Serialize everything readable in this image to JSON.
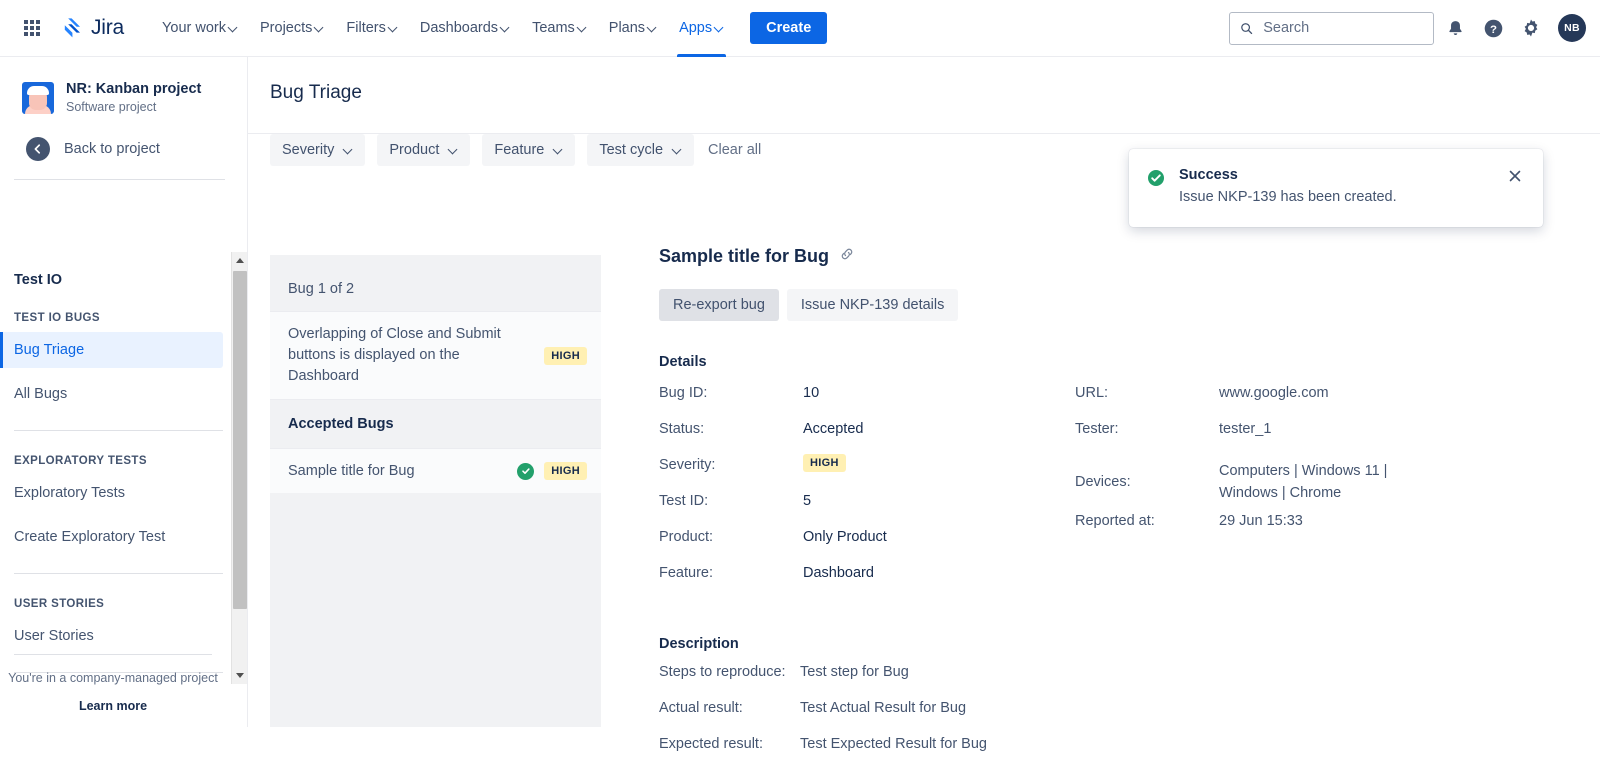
{
  "topnav": {
    "app_switcher": "app-switcher",
    "brand": "Jira",
    "items": [
      {
        "label": "Your work",
        "active": false
      },
      {
        "label": "Projects",
        "active": false
      },
      {
        "label": "Filters",
        "active": false
      },
      {
        "label": "Dashboards",
        "active": false
      },
      {
        "label": "Teams",
        "active": false
      },
      {
        "label": "Plans",
        "active": false
      },
      {
        "label": "Apps",
        "active": true
      }
    ],
    "create_label": "Create",
    "search_placeholder": "Search",
    "search_value": "",
    "avatar_initials": "NB"
  },
  "sidebar": {
    "project_name": "NR: Kanban project",
    "project_type": "Software project",
    "back_label": "Back to project",
    "app_title": "Test IO",
    "groups": [
      {
        "label": "TEST IO BUGS",
        "items": [
          {
            "label": "Bug Triage",
            "selected": true
          },
          {
            "label": "All Bugs",
            "selected": false
          }
        ]
      },
      {
        "label": "EXPLORATORY TESTS",
        "items": [
          {
            "label": "Exploratory Tests",
            "selected": false
          },
          {
            "label": "Create Exploratory Test",
            "selected": false
          }
        ]
      },
      {
        "label": "USER STORIES",
        "items": [
          {
            "label": "User Stories",
            "selected": false
          }
        ]
      }
    ],
    "footer_text": "You're in a company-managed project",
    "footer_link": "Learn more"
  },
  "page": {
    "title": "Bug Triage"
  },
  "filters": {
    "buttons": [
      "Severity",
      "Product",
      "Feature",
      "Test cycle"
    ],
    "clear_all": "Clear all"
  },
  "bug_list": {
    "count_label": "Bug 1 of 2",
    "pending": {
      "title": "Overlapping of Close and Submit buttons is displayed on the Dashboard",
      "severity": "HIGH"
    },
    "group_label": "Accepted Bugs",
    "accepted": [
      {
        "title": "Sample title for Bug",
        "severity": "HIGH",
        "accepted": true
      }
    ]
  },
  "detail": {
    "title": "Sample title for Bug",
    "actions": [
      {
        "label": "Re-export bug",
        "active": true
      },
      {
        "label": "Issue NKP-139 details",
        "active": false
      }
    ],
    "details_heading": "Details",
    "left_fields": [
      {
        "key": "Bug ID:",
        "value": "10",
        "type": "text"
      },
      {
        "key": "Status:",
        "value": "Accepted",
        "type": "text"
      },
      {
        "key": "Severity:",
        "value": "HIGH",
        "type": "badge"
      },
      {
        "key": "Test ID:",
        "value": "5",
        "type": "text"
      },
      {
        "key": "Product:",
        "value": "Only Product",
        "type": "text"
      },
      {
        "key": "Feature:",
        "value": "Dashboard",
        "type": "text"
      }
    ],
    "right_fields": [
      {
        "key": "URL:",
        "value": "www.google.com",
        "type": "text"
      },
      {
        "key": "Tester:",
        "value": "tester_1",
        "type": "text"
      },
      {
        "key": "Devices:",
        "value": "Computers | Windows 11 | Windows | Chrome",
        "type": "text"
      },
      {
        "key": "Reported at:",
        "value": "29 Jun 15:33",
        "type": "text"
      }
    ],
    "description_heading": "Description",
    "description_fields": [
      {
        "key": "Steps to reproduce:",
        "value": "Test step for Bug"
      },
      {
        "key": "Actual result:",
        "value": "Test Actual Result for Bug"
      },
      {
        "key": "Expected result:",
        "value": "Test Expected Result for Bug"
      }
    ]
  },
  "toast": {
    "title": "Success",
    "message": "Issue NKP-139 has been created."
  },
  "colors": {
    "brand_blue": "#0C66E4",
    "severity_high_bg": "#FFF0B3",
    "success_green": "#22A06B",
    "selected_nav_bg": "#E9F2FF"
  }
}
